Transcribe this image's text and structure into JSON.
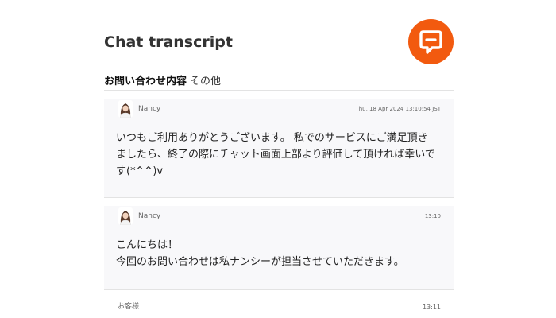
{
  "header": {
    "title": "Chat transcript",
    "logo_icon": "chat-bubble-icon",
    "logo_color": "#f25a0f"
  },
  "subject": {
    "label": "お問い合わせ内容",
    "value": "その他"
  },
  "messages": [
    {
      "sender": "Nancy",
      "avatar_icon": "agent-avatar-icon",
      "timestamp": "Thu, 18 Apr 2024 13:10:54 JST",
      "lines": [
        "いつもご利用ありがとうございます。 私でのサービスにご満足頂き",
        "ましたら、終了の際にチャット画面上部より評価して頂ければ幸いで",
        "す(*^^)v"
      ]
    },
    {
      "sender": "Nancy",
      "avatar_icon": "agent-avatar-icon",
      "timestamp": "13:10",
      "lines": [
        "こんにちは！",
        "今回のお問い合わせは私ナンシーが担当させていただきます。"
      ]
    },
    {
      "sender": "お客様",
      "timestamp": "13:11",
      "lines": []
    }
  ]
}
